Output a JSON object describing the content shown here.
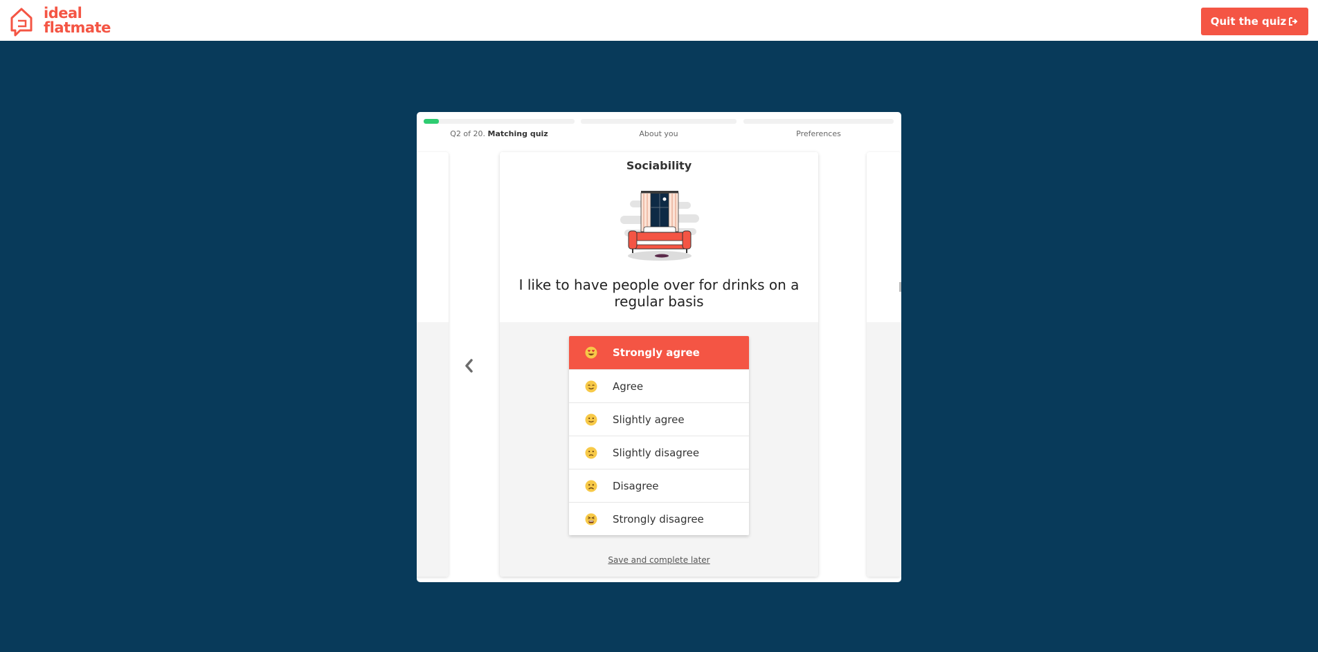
{
  "header": {
    "logo_line1": "ideal",
    "logo_line2": "flatmate",
    "quit_label": "Quit the quiz"
  },
  "progress": {
    "step1_prefix": "Q2 of 20.",
    "step1_name": "Matching quiz",
    "step1_fill": 0.1,
    "step2_name": "About you",
    "step3_name": "Preferences"
  },
  "card": {
    "title": "Sociability",
    "question": "I like to have people over for drinks on a regular basis",
    "answers": [
      {
        "label": "Strongly agree",
        "icon": "heart-eyes-emoji-icon",
        "selected": true
      },
      {
        "label": "Agree",
        "icon": "content-emoji-icon",
        "selected": false
      },
      {
        "label": "Slightly agree",
        "icon": "slight-smile-emoji-icon",
        "selected": false
      },
      {
        "label": "Slightly disagree",
        "icon": "slight-frown-emoji-icon",
        "selected": false
      },
      {
        "label": "Disagree",
        "icon": "frown-emoji-icon",
        "selected": false
      },
      {
        "label": "Strongly disagree",
        "icon": "tired-face-emoji-icon",
        "selected": false
      }
    ],
    "save_link": "Save and complete later"
  },
  "colors": {
    "brand": "#f45544",
    "background": "#083a5a",
    "progress_fill": "#2ecc71"
  }
}
